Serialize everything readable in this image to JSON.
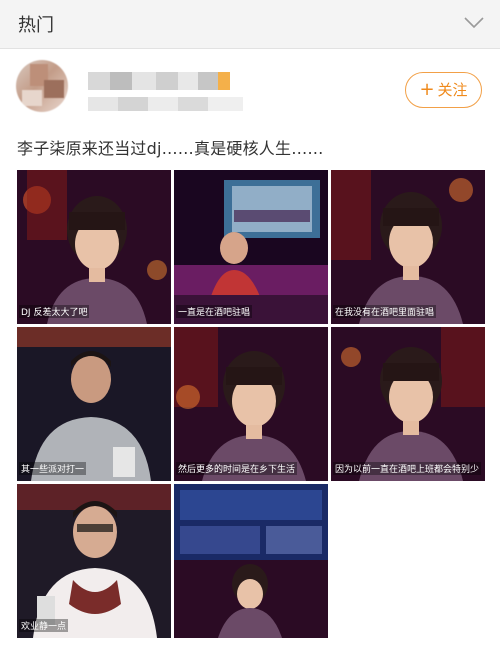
{
  "header": {
    "title": "热门",
    "chevron_icon": "chevron-down-icon"
  },
  "post": {
    "follow_label": "关注",
    "follow_color": "#ef8a1c",
    "text": "李子柒原来还当过dj……真是硬核人生……"
  },
  "images": [
    {
      "caption": "DJ 反差太大了吧"
    },
    {
      "caption": "一直是在酒吧驻唱"
    },
    {
      "caption": "在我没有在酒吧里面驻唱"
    },
    {
      "caption": "其一些派对打一"
    },
    {
      "caption": "然后更多的时间是在乡下生活"
    },
    {
      "caption": "因为以前一直在酒吧上班都会特别少"
    },
    {
      "caption": "欢业静一点"
    },
    {
      "caption": ""
    }
  ]
}
